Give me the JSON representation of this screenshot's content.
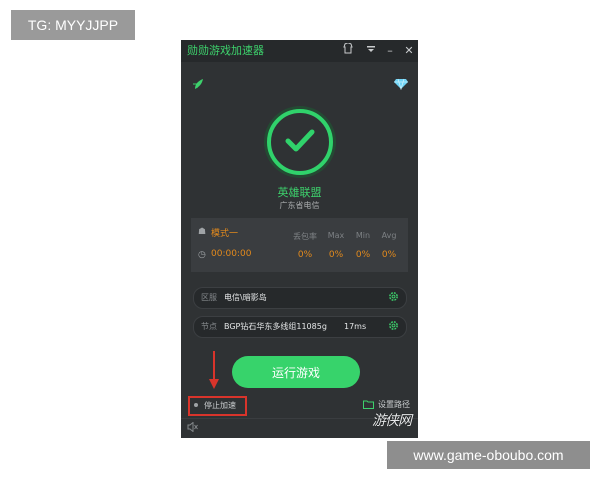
{
  "watermarks": {
    "top": "TG: MYYJJPP",
    "bottom": "www.game-oboubo.com",
    "logo": "游侠网"
  },
  "titlebar": {
    "title": "勋勋游戏加速器",
    "icons": [
      "skin-icon",
      "menu-icon",
      "minimize-icon",
      "close-icon"
    ],
    "minimize": "–",
    "close": "✕"
  },
  "status": {
    "game": "英雄联盟",
    "region": "广东省电信",
    "accent": "#30d26b"
  },
  "stats": {
    "mode": "模式一",
    "time": "00:00:00",
    "headers": [
      "丢包率",
      "Max",
      "Min",
      "Avg"
    ],
    "values": [
      "0%",
      "0%",
      "0%",
      "0%"
    ],
    "value_color": "#e38a1c"
  },
  "server": {
    "label": "区服",
    "value": "电信\\暗影岛"
  },
  "node": {
    "label": "节点",
    "value": "BGP钻石华东多线组11085g",
    "ping": "17ms"
  },
  "actions": {
    "run": "运行游戏",
    "stop": "停止加速",
    "path": "设置路径"
  }
}
